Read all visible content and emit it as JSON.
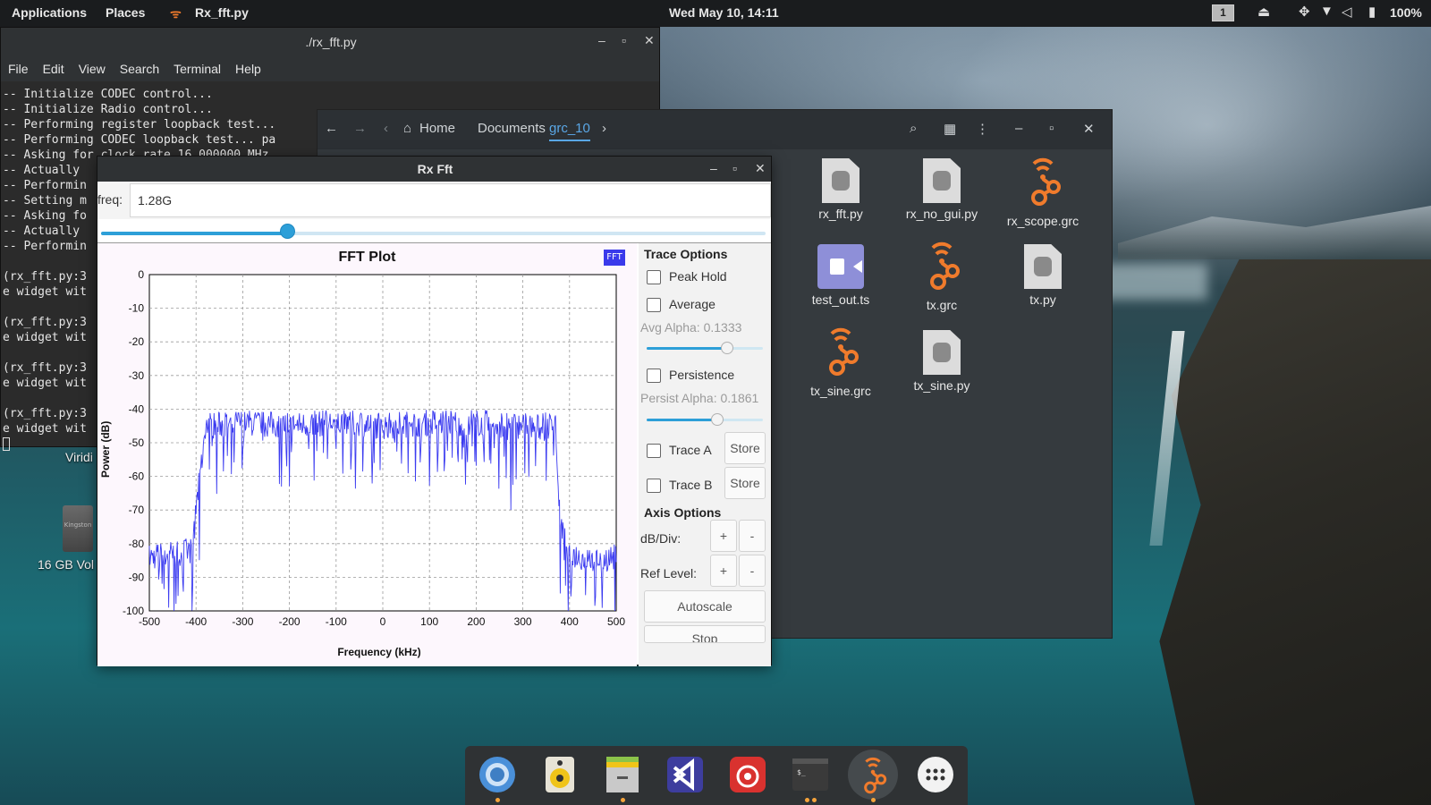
{
  "topbar": {
    "applications": "Applications",
    "places": "Places",
    "active_app": "Rx_fft.py",
    "clock": "Wed May 10, 14:11",
    "workspace": "1",
    "battery": "100%"
  },
  "terminal": {
    "title": "./rx_fft.py",
    "menu": [
      "File",
      "Edit",
      "View",
      "Search",
      "Terminal",
      "Help"
    ],
    "lines": [
      "-- Initialize CODEC control...",
      "-- Initialize Radio control...",
      "-- Performing register loopback test...",
      "-- Performing CODEC loopback test... pa",
      "-- Asking for clock rate 16.000000 MHz.",
      "-- Actually",
      "-- Performin",
      "-- Setting m",
      "-- Asking fo",
      "-- Actually",
      "-- Performin",
      "",
      "(rx_fft.py:3",
      "e widget wit",
      "",
      "(rx_fft.py:3",
      "e widget wit",
      "",
      "(rx_fft.py:3",
      "e widget wit",
      "",
      "(rx_fft.py:3",
      "e widget wit"
    ]
  },
  "desktop": {
    "viridi_label": "Viridi",
    "usb_label": "16 GB Vol",
    "usb_brand": "Kingston"
  },
  "files": {
    "crumbs": {
      "home": "Home",
      "documents": "Documents",
      "current": "grc_10"
    },
    "items": [
      {
        "name": "rx_fft.py",
        "kind": "python"
      },
      {
        "name": "rx_no_gui.py",
        "kind": "python"
      },
      {
        "name": "rx_scope.grc",
        "kind": "grc"
      },
      {
        "name": "test_out.ts",
        "kind": "video"
      },
      {
        "name": "tx.grc",
        "kind": "grc"
      },
      {
        "name": "tx.py",
        "kind": "python"
      },
      {
        "name": "tx_sine.grc",
        "kind": "grc"
      },
      {
        "name": "tx_sine.py",
        "kind": "python"
      }
    ]
  },
  "rxfft": {
    "title": "Rx Fft",
    "freq_label": "freq:",
    "freq_value": "1.28G",
    "freq_slider_fraction": 0.28,
    "plot": {
      "title": "FFT Plot",
      "badge": "FFT",
      "ylabel": "Power (dB)",
      "xlabel": "Frequency (kHz)"
    },
    "options": {
      "trace_options": "Trace Options",
      "peak_hold": "Peak Hold",
      "average": "Average",
      "avg_alpha": "Avg Alpha: 0.1333",
      "avg_alpha_fraction": 0.69,
      "persistence": "Persistence",
      "persist_alpha": "Persist Alpha: 0.1861",
      "persist_alpha_fraction": 0.61,
      "trace_a": "Trace A",
      "trace_b": "Trace B",
      "store": "Store",
      "axis_options": "Axis Options",
      "db_div": "dB/Div:",
      "ref_level": "Ref Level:",
      "plus": "+",
      "minus": "-",
      "autoscale": "Autoscale",
      "stop": "Stop"
    }
  },
  "chart_data": {
    "type": "line",
    "title": "FFT Plot",
    "xlabel": "Frequency (kHz)",
    "ylabel": "Power (dB)",
    "xlim": [
      -500,
      500
    ],
    "ylim": [
      -100,
      0
    ],
    "x_ticks": [
      -500,
      -400,
      -300,
      -200,
      -100,
      0,
      100,
      200,
      300,
      400,
      500
    ],
    "y_ticks": [
      0,
      -10,
      -20,
      -30,
      -40,
      -50,
      -60,
      -70,
      -80,
      -90,
      -100
    ],
    "grid": true,
    "series": [
      {
        "color": "#3b3bf0",
        "x": [
          -500,
          -450,
          -410,
          -400,
          -380,
          -300,
          -200,
          -100,
          0,
          100,
          200,
          300,
          370,
          380,
          400,
          450,
          500
        ],
        "values": [
          -84,
          -83,
          -82,
          -70,
          -45,
          -44,
          -45,
          -44,
          -45,
          -44,
          -44,
          -45,
          -45,
          -75,
          -83,
          -85,
          -84
        ]
      }
    ]
  },
  "dock": {
    "apps": [
      "chromium",
      "rhythmbox",
      "files",
      "vscode",
      "netease-music",
      "terminal",
      "gnuradio",
      "app-grid"
    ]
  }
}
